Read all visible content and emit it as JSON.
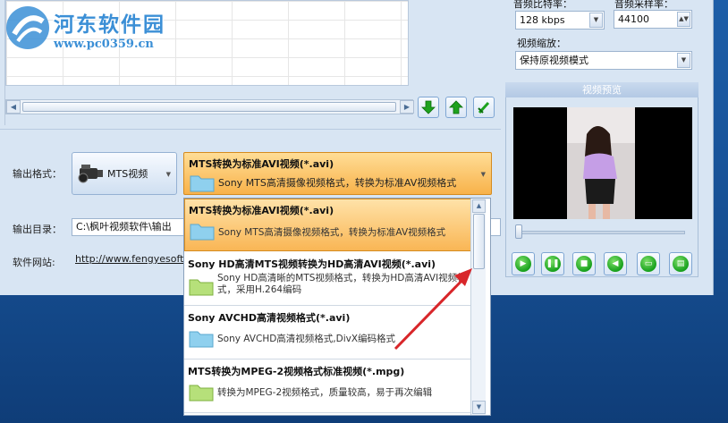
{
  "watermark": {
    "name": "河东软件园",
    "url": "www.pc0359.cn"
  },
  "left": {
    "output_format_label": "输出格式：",
    "format_button_label": "MTS视频",
    "selected_format": {
      "title": "MTS转换为标准AVI视频(*.avi)",
      "desc": "Sony MTS高清摄像视频格式，转换为标准AV视频格式"
    },
    "output_dir_label": "输出目录：",
    "output_dir_value": "C:\\枫叶视频软件\\输出",
    "website_label": "软件网站:",
    "website_url": "http://www.fengyesoft.c"
  },
  "format_list": [
    {
      "title": "MTS转换为标准AVI视频(*.avi)",
      "desc": "Sony MTS高清摄像视频格式，转换为标准AV视频格式",
      "selected": true,
      "icon_color": "#8fd0ee"
    },
    {
      "title": "Sony HD高清MTS视频转换为HD高清AVI视频(*.avi)",
      "desc": "Sony HD高清晰的MTS视频格式，转换为HD高清AVI视频格式，采用H.264编码",
      "selected": false,
      "icon_color": "#b6e07a"
    },
    {
      "title": "Sony AVCHD高清视频格式(*.avi)",
      "desc": "Sony AVCHD高清视频格式,DivX编码格式",
      "selected": false,
      "icon_color": "#8fd0ee"
    },
    {
      "title": "MTS转换为MPEG-2视频格式标准视频(*.mpg)",
      "desc": "转换为MPEG-2视频格式，质量较高，易于再次编辑",
      "selected": false,
      "icon_color": "#b6e07a"
    }
  ],
  "right": {
    "audio_bitrate_label": "音频比特率：",
    "audio_bitrate_value": "128 kbps",
    "audio_samplerate_label": "音频采样率：",
    "audio_samplerate_value": "44100",
    "video_scale_label": "视频缩放：",
    "video_scale_value": "保持原视频模式",
    "preview_title": "视频预览"
  }
}
